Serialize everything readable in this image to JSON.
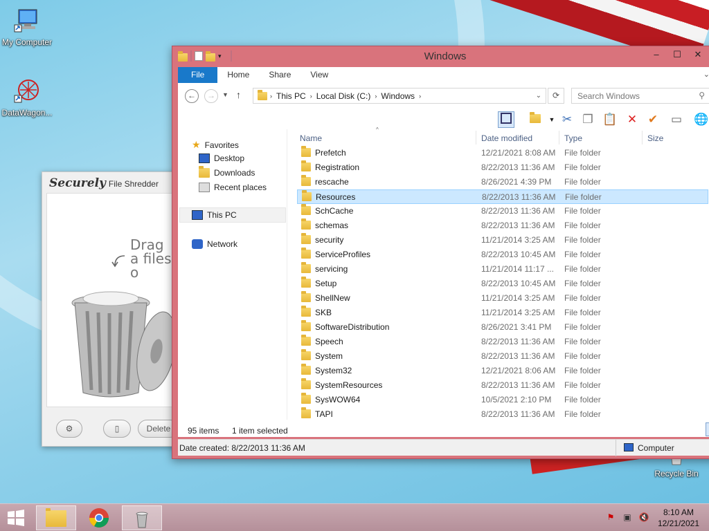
{
  "desktop": {
    "icons": [
      {
        "label": "My Computer"
      },
      {
        "label": "DataWagon..."
      },
      {
        "label": "Recycle Bin"
      }
    ]
  },
  "shredder": {
    "title_brand": "Securely",
    "title_rest": "File Shredder",
    "drag_text": "Drag a files o",
    "delete_label": "Delete"
  },
  "explorer": {
    "title": "Windows",
    "ribbon_tabs": [
      "File",
      "Home",
      "Share",
      "View"
    ],
    "breadcrumb": [
      "This PC",
      "Local Disk (C:)",
      "Windows"
    ],
    "search_placeholder": "Search Windows",
    "nav": {
      "favorites": "Favorites",
      "desktop": "Desktop",
      "downloads": "Downloads",
      "recent": "Recent places",
      "thispc": "This PC",
      "network": "Network"
    },
    "columns": {
      "name": "Name",
      "date": "Date modified",
      "type": "Type",
      "size": "Size"
    },
    "files": [
      {
        "name": "Prefetch",
        "date": "12/21/2021 8:08 AM",
        "type": "File folder"
      },
      {
        "name": "Registration",
        "date": "8/22/2013 11:36 AM",
        "type": "File folder"
      },
      {
        "name": "rescache",
        "date": "8/26/2021 4:39 PM",
        "type": "File folder"
      },
      {
        "name": "Resources",
        "date": "8/22/2013 11:36 AM",
        "type": "File folder",
        "selected": true
      },
      {
        "name": "SchCache",
        "date": "8/22/2013 11:36 AM",
        "type": "File folder"
      },
      {
        "name": "schemas",
        "date": "8/22/2013 11:36 AM",
        "type": "File folder"
      },
      {
        "name": "security",
        "date": "11/21/2014 3:25 AM",
        "type": "File folder"
      },
      {
        "name": "ServiceProfiles",
        "date": "8/22/2013 10:45 AM",
        "type": "File folder"
      },
      {
        "name": "servicing",
        "date": "11/21/2014 11:17 ...",
        "type": "File folder"
      },
      {
        "name": "Setup",
        "date": "8/22/2013 10:45 AM",
        "type": "File folder"
      },
      {
        "name": "ShellNew",
        "date": "11/21/2014 3:25 AM",
        "type": "File folder"
      },
      {
        "name": "SKB",
        "date": "11/21/2014 3:25 AM",
        "type": "File folder"
      },
      {
        "name": "SoftwareDistribution",
        "date": "8/26/2021 3:41 PM",
        "type": "File folder"
      },
      {
        "name": "Speech",
        "date": "8/22/2013 11:36 AM",
        "type": "File folder"
      },
      {
        "name": "System",
        "date": "8/22/2013 11:36 AM",
        "type": "File folder"
      },
      {
        "name": "System32",
        "date": "12/21/2021 8:06 AM",
        "type": "File folder"
      },
      {
        "name": "SystemResources",
        "date": "8/22/2013 11:36 AM",
        "type": "File folder"
      },
      {
        "name": "SysWOW64",
        "date": "10/5/2021 2:10 PM",
        "type": "File folder"
      },
      {
        "name": "TAPI",
        "date": "8/22/2013 11:36 AM",
        "type": "File folder"
      }
    ],
    "status": {
      "items": "95 items",
      "selected": "1 item selected"
    },
    "details": {
      "date_created": "Date created: 8/22/2013 11:36 AM",
      "location": "Computer"
    }
  },
  "taskbar": {
    "time": "8:10 AM",
    "date": "12/21/2021"
  }
}
